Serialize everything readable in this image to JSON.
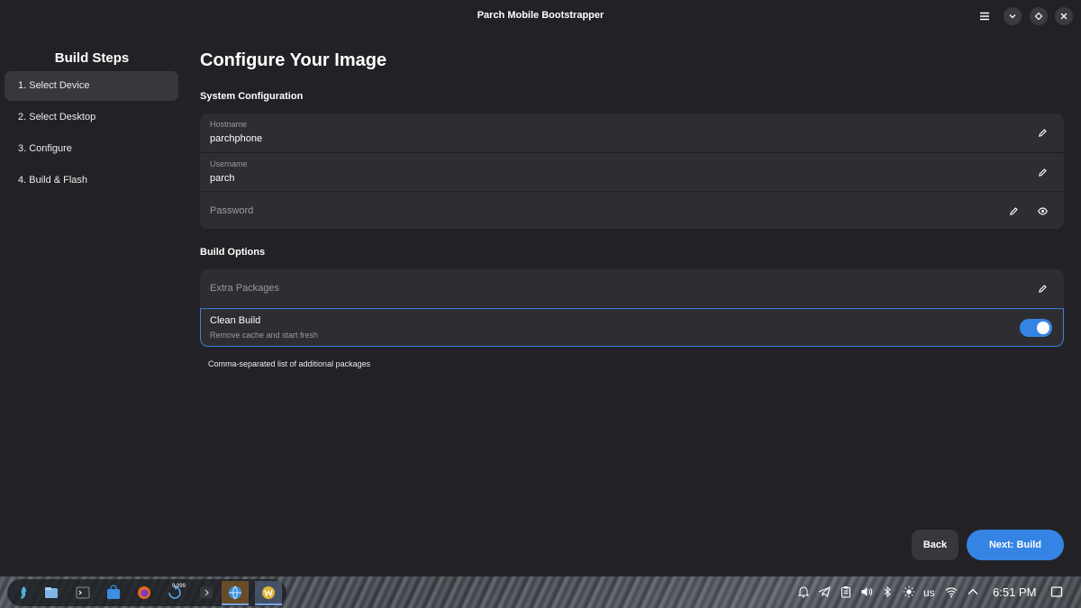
{
  "window": {
    "title": "Parch Mobile Bootstrapper",
    "icons": [
      "menu-icon",
      "minimize-icon",
      "maximize-icon",
      "close-icon"
    ]
  },
  "sidebar": {
    "title": "Build Steps",
    "steps": [
      {
        "label": "1. Select Device",
        "active": true
      },
      {
        "label": "2. Select Desktop",
        "active": false
      },
      {
        "label": "3. Configure",
        "active": false
      },
      {
        "label": "4. Build & Flash",
        "active": false
      }
    ]
  },
  "main": {
    "title": "Configure Your Image",
    "system_section": {
      "title": "System Configuration",
      "hostname": {
        "label": "Hostname",
        "value": "parchphone"
      },
      "username": {
        "label": "Username",
        "value": "parch"
      },
      "password": {
        "placeholder": "Password"
      }
    },
    "build_section": {
      "title": "Build Options",
      "extra_packages": {
        "placeholder": "Extra Packages"
      },
      "clean_build": {
        "title": "Clean Build",
        "subtitle": "Remove cache and start fresh",
        "enabled": true
      },
      "hint": "Comma-separated list of additional packages"
    },
    "buttons": {
      "back": "Back",
      "next": "Next: Build"
    }
  },
  "taskbar": {
    "apps": [
      "app-launcher-icon",
      "file-manager-icon",
      "terminal-icon",
      "store-icon",
      "firefox-icon",
      "updater-icon",
      "chevron-right-icon",
      "browser-icon",
      "app-w-icon"
    ],
    "updater_badge": "9,999",
    "tray": {
      "keyboard_layout": "us",
      "clock": "6:51 PM"
    }
  },
  "colors": {
    "accent": "#3584e4",
    "background": "#222226",
    "card": "#2e2e32"
  }
}
